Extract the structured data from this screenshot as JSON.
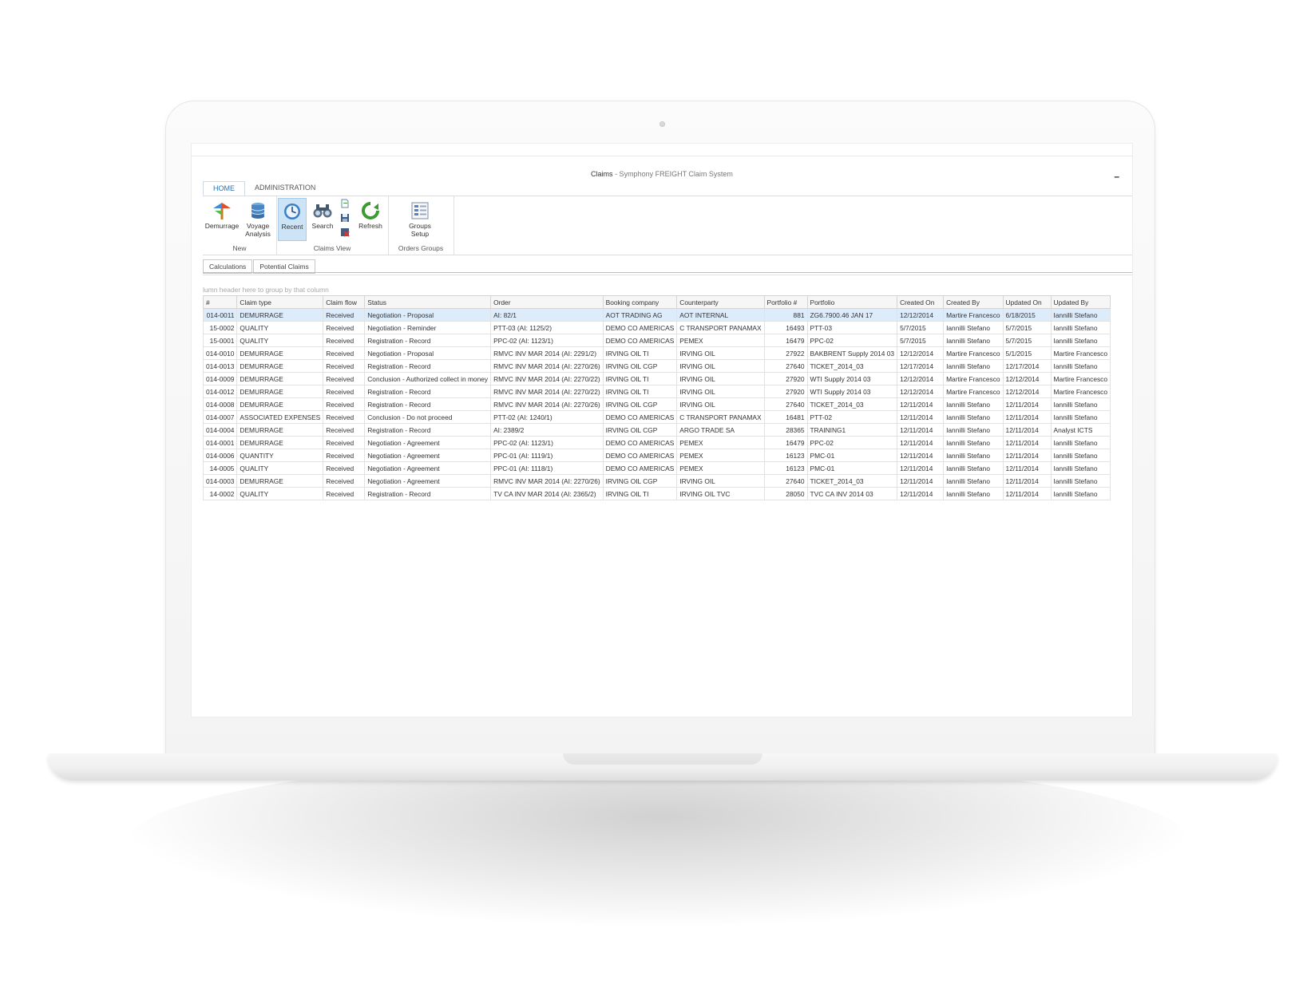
{
  "window": {
    "title_main": "Claims",
    "title_rest": " - Symphony FREIGHT Claim System",
    "minimize_label": "–"
  },
  "tabs": [
    {
      "label": "HOME",
      "active": true
    },
    {
      "label": "ADMINISTRATION",
      "active": false
    }
  ],
  "ribbon": {
    "groups": [
      {
        "label": "New"
      },
      {
        "label": "Claims View"
      },
      {
        "label": "Orders Groups"
      }
    ],
    "buttons": {
      "demurrage": {
        "line1": "Demurrage",
        "line2": "",
        "icon": "demurrage-icon"
      },
      "voyage": {
        "line1": "Voyage",
        "line2": "Analysis",
        "icon": "database-icon"
      },
      "recent": {
        "line1": "Recent",
        "line2": "",
        "icon": "clock-icon"
      },
      "search": {
        "line1": "Search",
        "line2": "",
        "icon": "binoculars-icon"
      },
      "refresh": {
        "line1": "Refresh",
        "line2": "",
        "icon": "refresh-icon"
      },
      "groups": {
        "line1": "Groups",
        "line2": "Setup",
        "icon": "groups-setup-icon"
      }
    }
  },
  "subtabs": [
    "Calculations",
    "Potential Claims"
  ],
  "group_hint": "lumn header here to group by that column",
  "grid": {
    "columns": [
      "#",
      "Claim type",
      "Claim flow",
      "Status",
      "Order",
      "Booking company",
      "Counterparty",
      "Portfolio #",
      "Portfolio",
      "Created On",
      "Created By",
      "Updated On",
      "Updated By"
    ],
    "rows": [
      [
        "014-0011",
        "DEMURRAGE",
        "Received",
        "Negotiation - Proposal",
        "AI: 82/1",
        "AOT TRADING AG",
        "AOT INTERNAL",
        "881",
        "ZG6.7900.46 JAN 17",
        "12/12/2014",
        "Martire Francesco",
        "6/18/2015",
        "Iannilli Stefano"
      ],
      [
        "15-0002",
        "QUALITY",
        "Received",
        "Negotiation - Reminder",
        "PTT-03 (AI: 1125/2)",
        "DEMO CO AMERICAS",
        "C TRANSPORT PANAMAX",
        "16493",
        "PTT-03",
        "5/7/2015",
        "Iannilli Stefano",
        "5/7/2015",
        "Iannilli Stefano"
      ],
      [
        "15-0001",
        "QUALITY",
        "Received",
        "Registration - Record",
        "PPC-02 (AI: 1123/1)",
        "DEMO CO AMERICAS",
        "PEMEX",
        "16479",
        "PPC-02",
        "5/7/2015",
        "Iannilli Stefano",
        "5/7/2015",
        "Iannilli Stefano"
      ],
      [
        "014-0010",
        "DEMURRAGE",
        "Received",
        "Negotiation - Proposal",
        "RMVC INV MAR 2014 (AI: 2291/2)",
        "IRVING OIL TI",
        "IRVING OIL",
        "27922",
        "BAKBRENT Supply 2014 03",
        "12/12/2014",
        "Martire Francesco",
        "5/1/2015",
        "Martire Francesco"
      ],
      [
        "014-0013",
        "DEMURRAGE",
        "Received",
        "Registration - Record",
        "RMVC INV MAR 2014 (AI: 2270/26)",
        "IRVING OIL CGP",
        "IRVING OIL",
        "27640",
        "TICKET_2014_03",
        "12/17/2014",
        "Iannilli Stefano",
        "12/17/2014",
        "Iannilli Stefano"
      ],
      [
        "014-0009",
        "DEMURRAGE",
        "Received",
        "Conclusion - Authorized collect in money",
        "RMVC INV MAR 2014 (AI: 2270/22)",
        "IRVING OIL TI",
        "IRVING OIL",
        "27920",
        "WTI Supply 2014 03",
        "12/12/2014",
        "Martire Francesco",
        "12/12/2014",
        "Martire Francesco"
      ],
      [
        "014-0012",
        "DEMURRAGE",
        "Received",
        "Registration - Record",
        "RMVC INV MAR 2014 (AI: 2270/22)",
        "IRVING OIL TI",
        "IRVING OIL",
        "27920",
        "WTI Supply 2014 03",
        "12/12/2014",
        "Martire Francesco",
        "12/12/2014",
        "Martire Francesco"
      ],
      [
        "014-0008",
        "DEMURRAGE",
        "Received",
        "Registration - Record",
        "RMVC INV MAR 2014 (AI: 2270/26)",
        "IRVING OIL CGP",
        "IRVING OIL",
        "27640",
        "TICKET_2014_03",
        "12/11/2014",
        "Iannilli Stefano",
        "12/11/2014",
        "Iannilli Stefano"
      ],
      [
        "014-0007",
        "ASSOCIATED EXPENSES",
        "Received",
        "Conclusion - Do not proceed",
        "PTT-02 (AI: 1240/1)",
        "DEMO CO AMERICAS",
        "C TRANSPORT PANAMAX",
        "16481",
        "PTT-02",
        "12/11/2014",
        "Iannilli Stefano",
        "12/11/2014",
        "Iannilli Stefano"
      ],
      [
        "014-0004",
        "DEMURRAGE",
        "Received",
        "Registration - Record",
        "AI: 2389/2",
        "IRVING OIL CGP",
        "ARGO TRADE SA",
        "28365",
        "TRAINING1",
        "12/11/2014",
        "Iannilli Stefano",
        "12/11/2014",
        "Analyst ICTS"
      ],
      [
        "014-0001",
        "DEMURRAGE",
        "Received",
        "Negotiation - Agreement",
        "PPC-02 (AI: 1123/1)",
        "DEMO CO AMERICAS",
        "PEMEX",
        "16479",
        "PPC-02",
        "12/11/2014",
        "Iannilli Stefano",
        "12/11/2014",
        "Iannilli Stefano"
      ],
      [
        "014-0006",
        "QUANTITY",
        "Received",
        "Negotiation - Agreement",
        "PPC-01 (AI: 1119/1)",
        "DEMO CO AMERICAS",
        "PEMEX",
        "16123",
        "PMC-01",
        "12/11/2014",
        "Iannilli Stefano",
        "12/11/2014",
        "Iannilli Stefano"
      ],
      [
        "14-0005",
        "QUALITY",
        "Received",
        "Negotiation - Agreement",
        "PPC-01 (AI: 1118/1)",
        "DEMO CO AMERICAS",
        "PEMEX",
        "16123",
        "PMC-01",
        "12/11/2014",
        "Iannilli Stefano",
        "12/11/2014",
        "Iannilli Stefano"
      ],
      [
        "014-0003",
        "DEMURRAGE",
        "Received",
        "Negotiation - Agreement",
        "RMVC INV MAR 2014 (AI: 2270/26)",
        "IRVING OIL CGP",
        "IRVING OIL",
        "27640",
        "TICKET_2014_03",
        "12/11/2014",
        "Iannilli Stefano",
        "12/11/2014",
        "Iannilli Stefano"
      ],
      [
        "14-0002",
        "QUALITY",
        "Received",
        "Registration - Record",
        "TV CA INV MAR 2014 (AI: 2365/2)",
        "IRVING OIL TI",
        "IRVING OIL TVC",
        "28050",
        "TVC CA INV 2014 03",
        "12/11/2014",
        "Iannilli Stefano",
        "12/11/2014",
        "Iannilli Stefano"
      ]
    ],
    "selected_row": 0
  },
  "colors": {
    "accent": "#2a72b8",
    "selected_row": "#dcecfb",
    "ribbon_active": "#cde4f7"
  }
}
